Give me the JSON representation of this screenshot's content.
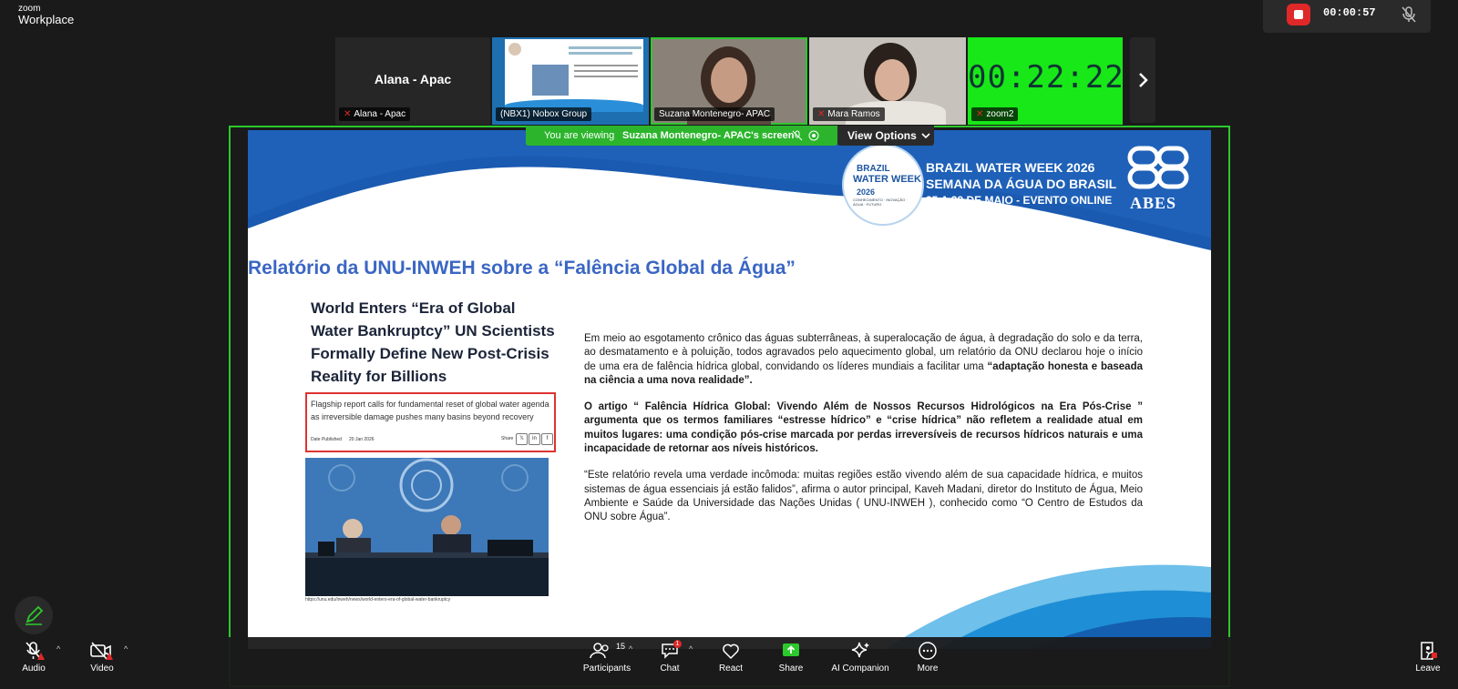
{
  "app": {
    "logo_small": "zoom",
    "logo_big": "Workplace"
  },
  "recording": {
    "time": "00:00:57"
  },
  "participants_strip": {
    "alana": {
      "center": "Alana - Apac",
      "label": "Alana - Apac"
    },
    "nbx": {
      "label": "(NBX1) Nobox Group"
    },
    "suzana": {
      "label": "Suzana Montenegro- APAC"
    },
    "mara": {
      "label": "Mara Ramos"
    },
    "zoom2": {
      "label": "zoom2",
      "clock": "00:22:22"
    }
  },
  "share_banner": {
    "prefix": "You are viewing",
    "owner": "Suzana Montenegro- APAC's screen",
    "view_options": "View Options"
  },
  "slide": {
    "title": "Relatório da UNU-INWEH sobre a “Falência Global da Água”",
    "badge": {
      "l1": "BRAZIL",
      "l2": "WATER WEEK",
      "l3": "2026",
      "l4": "CONHECIMENTO · INOVAÇÃO · ÁGUA · FUTURO"
    },
    "event": {
      "line1": "BRAZIL WATER WEEK 2026",
      "line2": "SEMANA DA ÁGUA DO BRASIL",
      "line3": "25 A 29 DE MAIO - EVENTO ONLINE"
    },
    "abes": "ABES",
    "article": {
      "headline": "World Enters “Era of Global Water Bankruptcy” UN Scientists Formally Define New Post-Crisis Reality for Billions",
      "subtitle": "Flagship report calls for fundamental reset of global water agenda as irreversible damage pushes many basins beyond recovery",
      "meta_label": "Date Published",
      "meta_date": "20 Jan 2026",
      "share_label": "Share",
      "url": "https://unu.edu/inweh/news/world-enters-era-of-global-water-bankruptcy"
    },
    "paragraphs": {
      "p1_a": "Em meio ao esgotamento crônico das águas subterrâneas, à superalocação de água, à degradação do solo e da terra, ao desmatamento e à poluição, todos agravados pelo aquecimento global, um relatório da ONU declarou hoje o início de uma era de falência hídrica global, convidando os líderes mundiais a facilitar uma ",
      "p1_b": "“adaptação honesta e baseada na ciência a uma nova realidade”.",
      "p2": "O artigo “ Falência Hídrica Global: Vivendo Além de Nossos Recursos Hidrológicos na Era Pós-Crise ” argumenta que os termos familiares “estresse hídrico” e “crise hídrica” não refletem a realidade atual em muitos lugares: uma condição pós-crise marcada por perdas irreversíveis de recursos hídricos naturais e uma incapacidade de retornar aos níveis históricos.",
      "p3": "“Este relatório revela uma verdade incômoda: muitas regiões estão vivendo além de sua capacidade hídrica, e muitos sistemas de água essenciais já estão falidos”, afirma o autor principal, Kaveh Madani, diretor do Instituto de Água, Meio Ambiente e Saúde da Universidade das Nações Unidas ( UNU-INWEH ), conhecido como “O Centro de Estudos da ONU sobre Água”."
    }
  },
  "toolbar": {
    "audio": "Audio",
    "video": "Video",
    "participants": "Participants",
    "participants_count": "15",
    "chat": "Chat",
    "chat_badge": "1",
    "react": "React",
    "share": "Share",
    "ai": "AI Companion",
    "more": "More",
    "leave": "Leave"
  },
  "colors": {
    "accent_green": "#2cc92c",
    "record_red": "#e02828",
    "slide_blue": "#1e56a0",
    "title_blue": "#3a66c4"
  }
}
